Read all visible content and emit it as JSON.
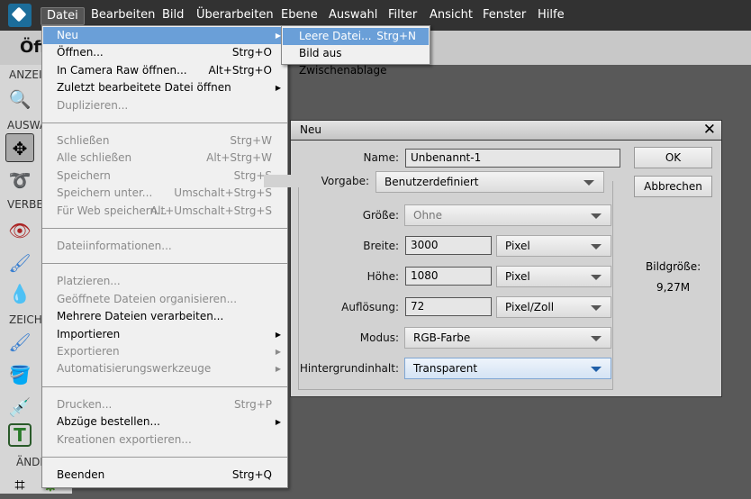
{
  "menubar": {
    "items": [
      "Datei",
      "Bearbeiten",
      "Bild",
      "Überarbeiten",
      "Ebene",
      "Auswahl",
      "Filter",
      "Ansicht",
      "Fenster",
      "Hilfe"
    ]
  },
  "topbar": {
    "title": "Öff"
  },
  "panel": {
    "sections": [
      "ANZEI",
      "AUSWÄ",
      "VERBE",
      "ZEICH",
      "ÄNDE"
    ]
  },
  "menu": {
    "items": [
      {
        "label": "Neu",
        "shortcut": "",
        "submenu": true,
        "enabled": true,
        "highlighted": true
      },
      {
        "label": "Öffnen...",
        "shortcut": "Strg+O",
        "enabled": true
      },
      {
        "label": "In Camera Raw öffnen...",
        "shortcut": "Alt+Strg+O",
        "enabled": true
      },
      {
        "label": "Zuletzt bearbeitete Datei öffnen",
        "shortcut": "",
        "submenu": true,
        "enabled": true
      },
      {
        "label": "Duplizieren...",
        "shortcut": "",
        "enabled": false
      },
      {
        "sep": true
      },
      {
        "label": "Schließen",
        "shortcut": "Strg+W",
        "enabled": false
      },
      {
        "label": "Alle schließen",
        "shortcut": "Alt+Strg+W",
        "enabled": false
      },
      {
        "label": "Speichern",
        "shortcut": "Strg+S",
        "enabled": false
      },
      {
        "label": "Speichern unter...",
        "shortcut": "Umschalt+Strg+S",
        "enabled": false
      },
      {
        "label": "Für Web speichern...",
        "shortcut": "Alt+Umschalt+Strg+S",
        "enabled": false
      },
      {
        "sep": true
      },
      {
        "label": "Dateiinformationen...",
        "shortcut": "",
        "enabled": false
      },
      {
        "sep": true
      },
      {
        "label": "Platzieren...",
        "shortcut": "",
        "enabled": false
      },
      {
        "label": "Geöffnete Dateien organisieren...",
        "shortcut": "",
        "enabled": false
      },
      {
        "label": "Mehrere Dateien verarbeiten...",
        "shortcut": "",
        "enabled": true
      },
      {
        "label": "Importieren",
        "shortcut": "",
        "submenu": true,
        "enabled": true
      },
      {
        "label": "Exportieren",
        "shortcut": "",
        "submenu": true,
        "enabled": false
      },
      {
        "label": "Automatisierungswerkzeuge",
        "shortcut": "",
        "submenu": true,
        "enabled": false
      },
      {
        "sep": true
      },
      {
        "label": "Drucken...",
        "shortcut": "Strg+P",
        "enabled": false
      },
      {
        "label": "Abzüge bestellen...",
        "shortcut": "",
        "submenu": true,
        "enabled": true
      },
      {
        "label": "Kreationen exportieren...",
        "shortcut": "",
        "enabled": false
      },
      {
        "sep": true
      },
      {
        "label": "Beenden",
        "shortcut": "Strg+Q",
        "enabled": true
      }
    ]
  },
  "submenu": {
    "items": [
      {
        "label": "Leere Datei...",
        "shortcut": "Strg+N"
      },
      {
        "label": "Bild aus Zwischenablage",
        "shortcut": ""
      }
    ]
  },
  "dialog": {
    "title": "Neu",
    "close": "✕",
    "name_label": "Name:",
    "name_value": "Unbenannt-1",
    "preset_label": "Vorgabe:",
    "preset_value": "Benutzerdefiniert",
    "size_label": "Größe:",
    "size_value": "Ohne",
    "width_label": "Breite:",
    "width_value": "3000",
    "width_unit": "Pixel",
    "height_label": "Höhe:",
    "height_value": "1080",
    "height_unit": "Pixel",
    "res_label": "Auflösung:",
    "res_value": "72",
    "res_unit": "Pixel/Zoll",
    "mode_label": "Modus:",
    "mode_value": "RGB-Farbe",
    "bg_label": "Hintergrundinhalt:",
    "bg_value": "Transparent",
    "ok": "OK",
    "cancel": "Abbrechen",
    "imgsize_label": "Bildgröße:",
    "imgsize_value": "9,27M"
  }
}
